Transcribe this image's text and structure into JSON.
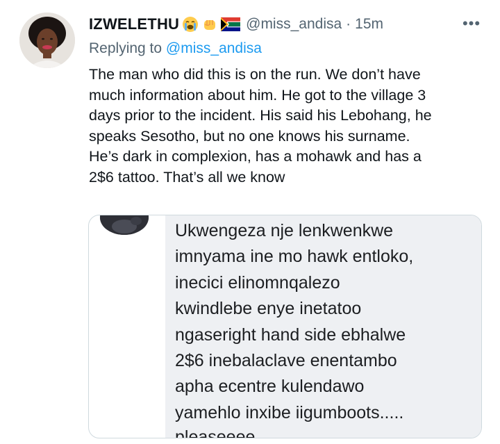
{
  "tweet": {
    "display_name": "IZWELETHU",
    "name_emojis": [
      "crying-face-emoji",
      "raised-fist-emoji",
      "south-africa-flag-emoji"
    ],
    "handle": "@miss_andisa",
    "separator": "·",
    "time": "15m",
    "more_label": "•••",
    "replying_prefix": "Replying to",
    "replying_to": "@miss_andisa",
    "body_lines": [
      "The man who did this is on the run. We don’t have",
      "much information about him. He got to the village 3",
      "days prior to the incident. His said his Lebohang, he",
      "speaks Sesotho, but no one knows his surname.",
      "He’s dark in complexion, has a mohawk and has a",
      "2$6 tattoo. That’s all we know"
    ]
  },
  "attached_image": {
    "message_lines": [
      "Ukwengeza nje lenkwenkwe",
      "imnyama ine mo hawk entloko,",
      "inecici elinomnqalezo",
      "kwindlebe enye inetatoo",
      "ngaseright hand side ebhalwe",
      "2$6 inebalaclave enentambo",
      "apha ecentre kulendawo",
      "yamehlo inxibe iigumboots....."
    ],
    "clipped_line": "pleaseeee"
  },
  "colors": {
    "text_primary": "#0f1419",
    "text_secondary": "#536471",
    "link": "#1d9bf0",
    "media_border": "#cfd9de",
    "message_bubble": "#eef0f3"
  }
}
